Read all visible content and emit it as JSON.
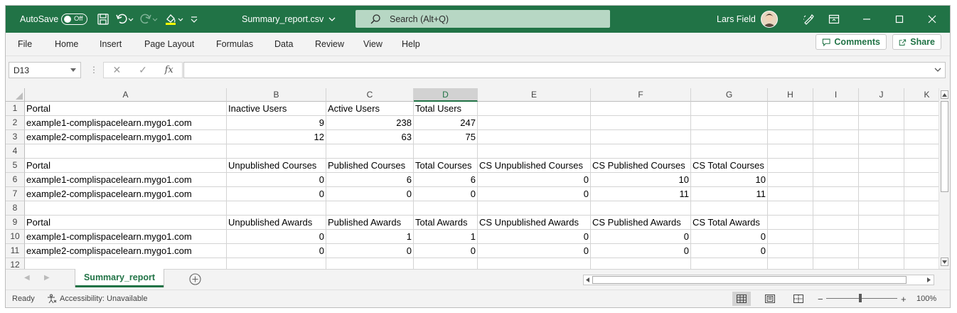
{
  "titlebar": {
    "autosave_label": "AutoSave",
    "autosave_state": "Off",
    "filename": "Summary_report.csv",
    "search_placeholder": "Search (Alt+Q)",
    "user_name": "Lars Field",
    "accent_color": "#217346"
  },
  "menu": {
    "items": [
      "File",
      "Home",
      "Insert",
      "Page Layout",
      "Formulas",
      "Data",
      "Review",
      "View",
      "Help"
    ],
    "comments_label": "Comments",
    "share_label": "Share"
  },
  "formula_bar": {
    "name_box": "D13",
    "formula": "",
    "fx_label": "fx"
  },
  "sheet": {
    "columns": [
      "A",
      "B",
      "C",
      "D",
      "E",
      "F",
      "G",
      "H",
      "I",
      "J",
      "K"
    ],
    "selected_column": "D",
    "row_numbers": [
      "1",
      "2",
      "3",
      "4",
      "5",
      "6",
      "7",
      "8",
      "9",
      "10",
      "11",
      "12"
    ],
    "rows": [
      [
        "Portal",
        "Inactive Users",
        "Active Users",
        "Total Users",
        "",
        "",
        ""
      ],
      [
        "example1-complispacelearn.mygo1.com",
        "9",
        "238",
        "247",
        "",
        "",
        ""
      ],
      [
        "example2-complispacelearn.mygo1.com",
        "12",
        "63",
        "75",
        "",
        "",
        ""
      ],
      [
        "",
        "",
        "",
        "",
        "",
        "",
        ""
      ],
      [
        "Portal",
        "Unpublished Courses",
        "Published Courses",
        "Total Courses",
        "CS Unpublished Courses",
        "CS Published Courses",
        "CS Total Courses"
      ],
      [
        "example1-complispacelearn.mygo1.com",
        "0",
        "6",
        "6",
        "0",
        "10",
        "10"
      ],
      [
        "example2-complispacelearn.mygo1.com",
        "0",
        "0",
        "0",
        "0",
        "11",
        "11"
      ],
      [
        "",
        "",
        "",
        "",
        "",
        "",
        ""
      ],
      [
        "Portal",
        "Unpublished Awards",
        "Published Awards",
        "Total Awards",
        "CS Unpublished Awards",
        "CS Published Awards",
        "CS Total Awards"
      ],
      [
        "example1-complispacelearn.mygo1.com",
        "0",
        "1",
        "1",
        "0",
        "0",
        "0"
      ],
      [
        "example2-complispacelearn.mygo1.com",
        "0",
        "0",
        "0",
        "0",
        "0",
        "0"
      ],
      [
        "",
        "",
        "",
        "",
        "",
        "",
        ""
      ]
    ]
  },
  "tabs": {
    "active": "Summary_report"
  },
  "status": {
    "ready": "Ready",
    "accessibility": "Accessibility: Unavailable",
    "zoom": "100%",
    "zoom_minus": "−",
    "zoom_plus": "+"
  }
}
